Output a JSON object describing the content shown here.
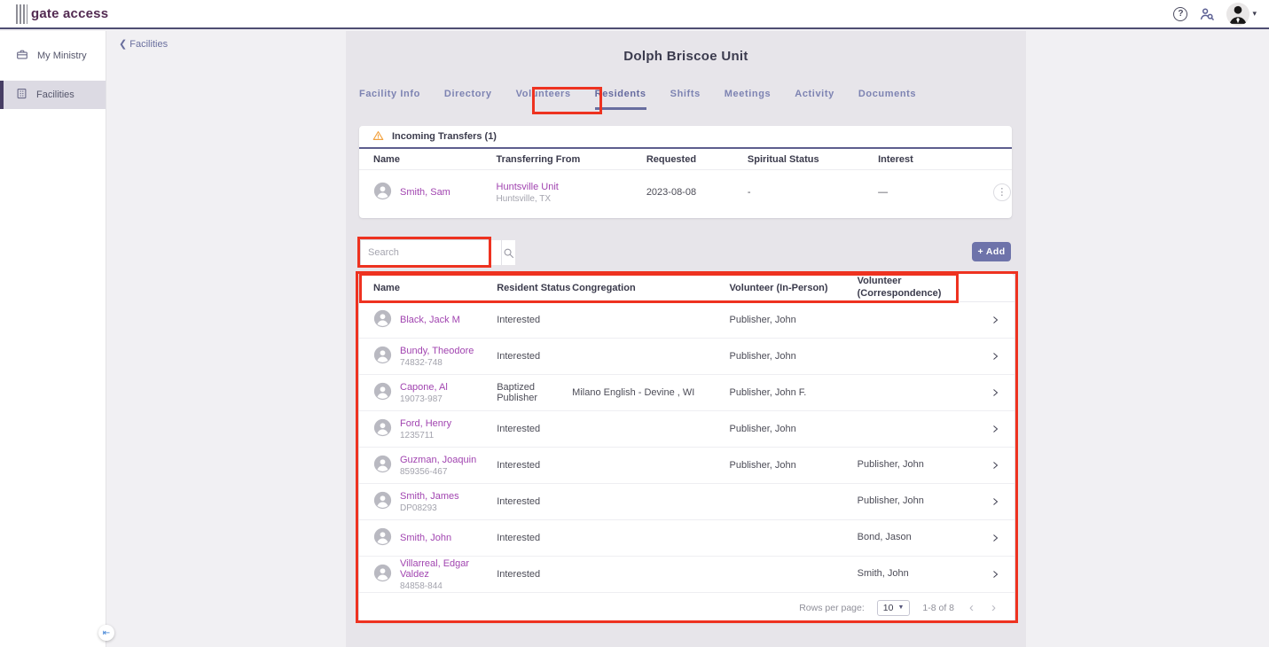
{
  "topbar": {
    "logo_text": "gate access",
    "icons": [
      "help-icon",
      "person-search-icon",
      "avatar",
      "caret-down-icon"
    ]
  },
  "sidebar": {
    "items": [
      {
        "label": "My Ministry",
        "icon": "briefcase-icon",
        "active": false
      },
      {
        "label": "Facilities",
        "icon": "building-icon",
        "active": true
      }
    ]
  },
  "breadcrumb": {
    "label": "Facilities",
    "chevron": "❮"
  },
  "page": {
    "title": "Dolph Briscoe Unit"
  },
  "tabs": {
    "items": [
      "Facility Info",
      "Directory",
      "Volunteers",
      "Residents",
      "Shifts",
      "Meetings",
      "Activity",
      "Documents"
    ],
    "active": "Residents"
  },
  "transfers": {
    "title": "Incoming Transfers (1)",
    "columns": [
      "Name",
      "Transferring From",
      "Requested",
      "Spiritual Status",
      "Interest"
    ],
    "rows": [
      {
        "name": "Smith, Sam",
        "from_unit": "Huntsville Unit",
        "from_location": "Huntsville, TX",
        "requested": "2023-08-08",
        "spiritual_status": "-",
        "interest": "—"
      }
    ]
  },
  "toolbar": {
    "search_placeholder": "Search",
    "add_label": "+ Add"
  },
  "residents": {
    "columns": [
      "Name",
      "Resident Status",
      "Congregation",
      "Volunteer (In-Person)",
      "Volunteer (Correspondence)"
    ],
    "rows": [
      {
        "name": "Black, Jack M",
        "id": "",
        "status": "Interested",
        "congregation": "",
        "vol_in_person": "Publisher, John",
        "vol_correspondence": ""
      },
      {
        "name": "Bundy, Theodore",
        "id": "74832-748",
        "status": "Interested",
        "congregation": "",
        "vol_in_person": "Publisher, John",
        "vol_correspondence": ""
      },
      {
        "name": "Capone, Al",
        "id": "19073-987",
        "status": "Baptized Publisher",
        "congregation": "Milano English - Devine , WI",
        "vol_in_person": "Publisher, John F.",
        "vol_correspondence": ""
      },
      {
        "name": "Ford, Henry",
        "id": "1235711",
        "status": "Interested",
        "congregation": "",
        "vol_in_person": "Publisher, John",
        "vol_correspondence": ""
      },
      {
        "name": "Guzman, Joaquin",
        "id": "859356-467",
        "status": "Interested",
        "congregation": "",
        "vol_in_person": "Publisher, John",
        "vol_correspondence": "Publisher, John"
      },
      {
        "name": "Smith, James",
        "id": "DP08293",
        "status": "Interested",
        "congregation": "",
        "vol_in_person": "",
        "vol_correspondence": "Publisher, John"
      },
      {
        "name": "Smith, John",
        "id": "",
        "status": "Interested",
        "congregation": "",
        "vol_in_person": "",
        "vol_correspondence": "Bond, Jason"
      },
      {
        "name": "Villarreal, Edgar Valdez",
        "id": "84858-844",
        "status": "Interested",
        "congregation": "",
        "vol_in_person": "",
        "vol_correspondence": "Smith, John"
      }
    ]
  },
  "pagination": {
    "label": "Rows per page:",
    "value": "10",
    "range": "1-8 of 8"
  },
  "colors": {
    "accent_purple": "#686d9f",
    "link_purple": "#a144b0",
    "topbar_rule": "#4e4d72",
    "warning_orange": "#f2a13e",
    "annotation_red": "#ee3220",
    "add_button": "#6e73aa",
    "sidebar_active_bg": "#dcdae3",
    "panel_bg": "#e7e5ea"
  }
}
